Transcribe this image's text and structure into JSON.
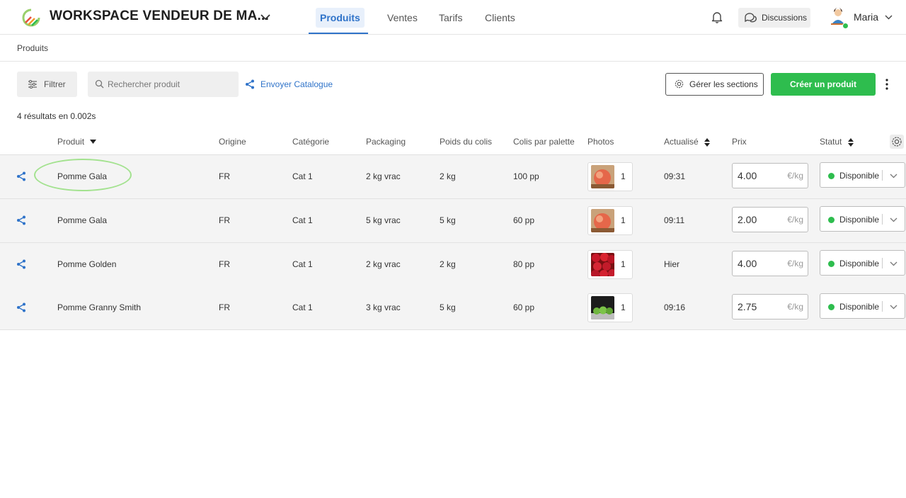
{
  "header": {
    "workspace_title": "WORKSPACE VENDEUR DE MA...",
    "nav": [
      {
        "label": "Produits",
        "active": true
      },
      {
        "label": "Ventes",
        "active": false
      },
      {
        "label": "Tarifs",
        "active": false
      },
      {
        "label": "Clients",
        "active": false
      }
    ],
    "discussions_label": "Discussions",
    "user_name": "Maria",
    "accent_color": "#2f73c9",
    "online_color": "#2ebd4e"
  },
  "breadcrumb": "Produits",
  "toolbar": {
    "filter_label": "Filtrer",
    "search_placeholder": "Rechercher produit",
    "send_catalog_label": "Envoyer Catalogue",
    "manage_sections_label": "Gérer les sections",
    "create_product_label": "Créer un produit",
    "create_button_color": "#2ebd4e"
  },
  "results_text": "4 résultats en 0.002s",
  "table": {
    "columns": [
      "Produit",
      "Origine",
      "Catégorie",
      "Packaging",
      "Poids du colis",
      "Colis par palette",
      "Photos",
      "Actualisé",
      "Prix",
      "Statut"
    ],
    "rows": [
      {
        "product": "Pomme Gala",
        "origin": "FR",
        "category": "Cat 1",
        "packaging": "2 kg vrac",
        "weight": "2 kg",
        "per_pallet": "100 pp",
        "photo_count": "1",
        "photo": "red-apple",
        "updated": "09:31",
        "price": "4.00",
        "price_unit": "€/kg",
        "status": "Disponible"
      },
      {
        "product": "Pomme Gala",
        "origin": "FR",
        "category": "Cat 1",
        "packaging": "5 kg vrac",
        "weight": "5 kg",
        "per_pallet": "60 pp",
        "photo_count": "1",
        "photo": "red-apple",
        "updated": "09:11",
        "price": "2.00",
        "price_unit": "€/kg",
        "status": "Disponible"
      },
      {
        "product": "Pomme Golden",
        "origin": "FR",
        "category": "Cat 1",
        "packaging": "2 kg vrac",
        "weight": "2 kg",
        "per_pallet": "80 pp",
        "photo_count": "1",
        "photo": "red-apple-pile",
        "updated": "Hier",
        "price": "4.00",
        "price_unit": "€/kg",
        "status": "Disponible"
      },
      {
        "product": "Pomme Granny Smith",
        "origin": "FR",
        "category": "Cat 1",
        "packaging": "3 kg vrac",
        "weight": "5 kg",
        "per_pallet": "60 pp",
        "photo_count": "1",
        "photo": "green-apples",
        "updated": "09:16",
        "price": "2.75",
        "price_unit": "€/kg",
        "status": "Disponible"
      }
    ]
  }
}
